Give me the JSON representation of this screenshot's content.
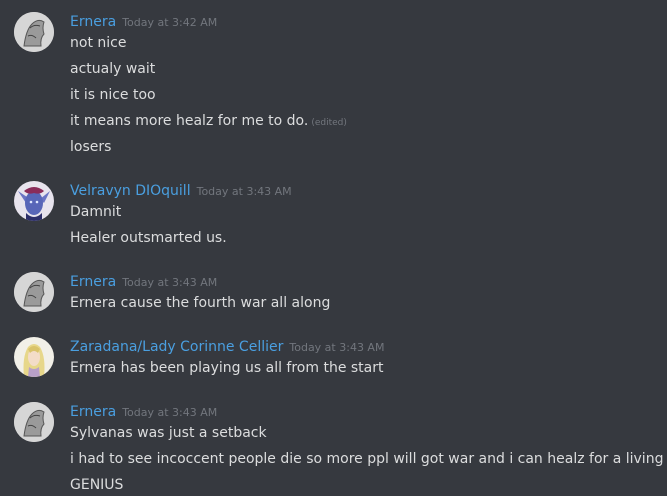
{
  "groups": [
    {
      "author": "Ernera",
      "timestamp": "Today at 3:42 AM",
      "avatar_icon": "grey-sketch-avatar",
      "messages": [
        {
          "text": "not nice"
        },
        {
          "text": "actualy wait"
        },
        {
          "text": "it is nice too"
        },
        {
          "text": "it means more healz for me to do.",
          "edited": "(edited)"
        },
        {
          "text": "losers"
        }
      ]
    },
    {
      "author": "Velravyn DIOquill",
      "timestamp": "Today at 3:43 AM",
      "avatar_icon": "blue-elf-avatar",
      "messages": [
        {
          "text": "Damnit"
        },
        {
          "text": "Healer outsmarted us."
        }
      ]
    },
    {
      "author": "Ernera",
      "timestamp": "Today at 3:43 AM",
      "avatar_icon": "grey-sketch-avatar",
      "messages": [
        {
          "text": "Ernera cause the fourth war all along"
        }
      ]
    },
    {
      "author": "Zaradana/Lady Corinne Cellier",
      "timestamp": "Today at 3:43 AM",
      "avatar_icon": "blonde-portrait-avatar",
      "messages": [
        {
          "text": "Ernera has been playing us all from the start"
        }
      ]
    },
    {
      "author": "Ernera",
      "timestamp": "Today at 3:43 AM",
      "avatar_icon": "grey-sketch-avatar",
      "messages": [
        {
          "text": "Sylvanas was just a setback"
        },
        {
          "text": "i had to see incoccent people die so more ppl will got war and i can healz for a living"
        },
        {
          "text": "GENIUS"
        }
      ]
    }
  ],
  "colors": {
    "background": "#36393f",
    "username": "#4a9fe0",
    "message_text": "#dcddde",
    "timestamp": "#72767d"
  }
}
